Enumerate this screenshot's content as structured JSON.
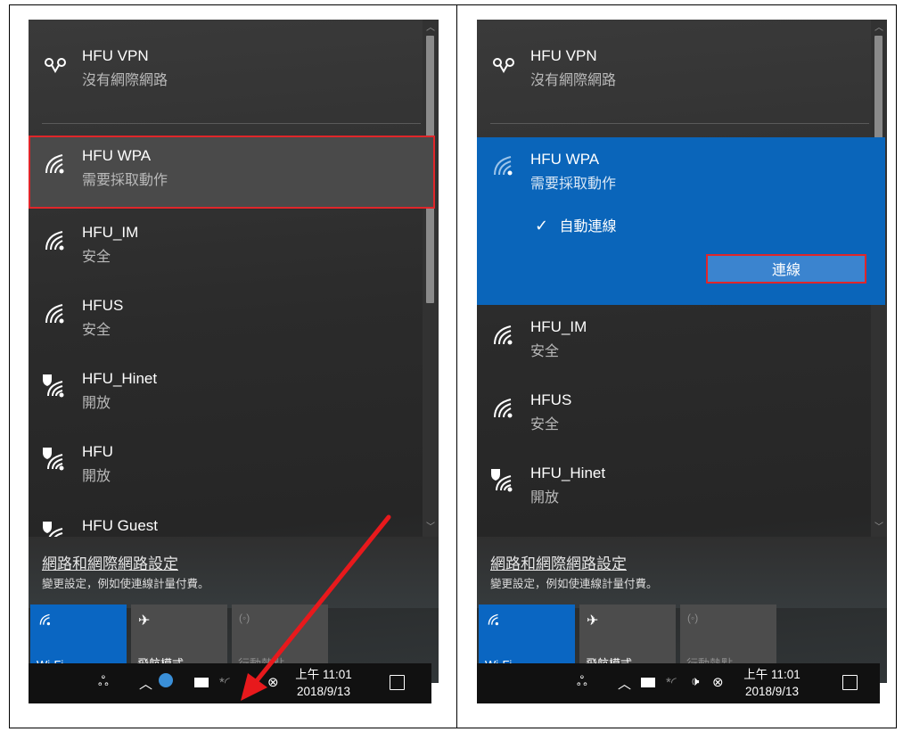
{
  "networks_left": [
    {
      "name": "HFU VPN",
      "status": "沒有網際網路",
      "icon": "vpn-icon"
    },
    {
      "name": "HFU WPA",
      "status": "需要採取動作",
      "icon": "wifi-icon"
    },
    {
      "name": "HFU_IM",
      "status": "安全",
      "icon": "wifi-icon"
    },
    {
      "name": "HFUS",
      "status": "安全",
      "icon": "wifi-icon"
    },
    {
      "name": "HFU_Hinet",
      "status": "開放",
      "icon": "wifi-shield-icon"
    },
    {
      "name": "HFU",
      "status": "開放",
      "icon": "wifi-shield-icon"
    },
    {
      "name": "HFU Guest",
      "status": "",
      "icon": "wifi-shield-icon"
    }
  ],
  "networks_right": [
    {
      "name": "HFU VPN",
      "status": "沒有網際網路",
      "icon": "vpn-icon"
    },
    {
      "name": "HFU WPA",
      "status": "需要採取動作",
      "icon": "wifi-icon"
    },
    {
      "name": "HFU_IM",
      "status": "安全",
      "icon": "wifi-icon"
    },
    {
      "name": "HFUS",
      "status": "安全",
      "icon": "wifi-icon"
    },
    {
      "name": "HFU_Hinet",
      "status": "開放",
      "icon": "wifi-shield-icon"
    }
  ],
  "expanded": {
    "auto_connect_label": "自動連線",
    "auto_connect_checked": true,
    "connect_label": "連線"
  },
  "settings": {
    "link": "網路和網際網路設定",
    "description": "變更設定，例如使連線計量付費。"
  },
  "tiles": [
    {
      "label": "Wi-Fi",
      "icon": "wifi-icon",
      "state": "on"
    },
    {
      "label": "飛航模式",
      "icon": "airplane-icon",
      "state": "off"
    },
    {
      "label": "行動熱點",
      "icon": "hotspot-icon",
      "state": "disabled"
    }
  ],
  "taskbar": {
    "time": "上午 11:01",
    "date": "2018/9/13"
  },
  "colors": {
    "accent": "#0a66c2",
    "highlight": "#e0262a",
    "arrow": "#e8191c"
  }
}
